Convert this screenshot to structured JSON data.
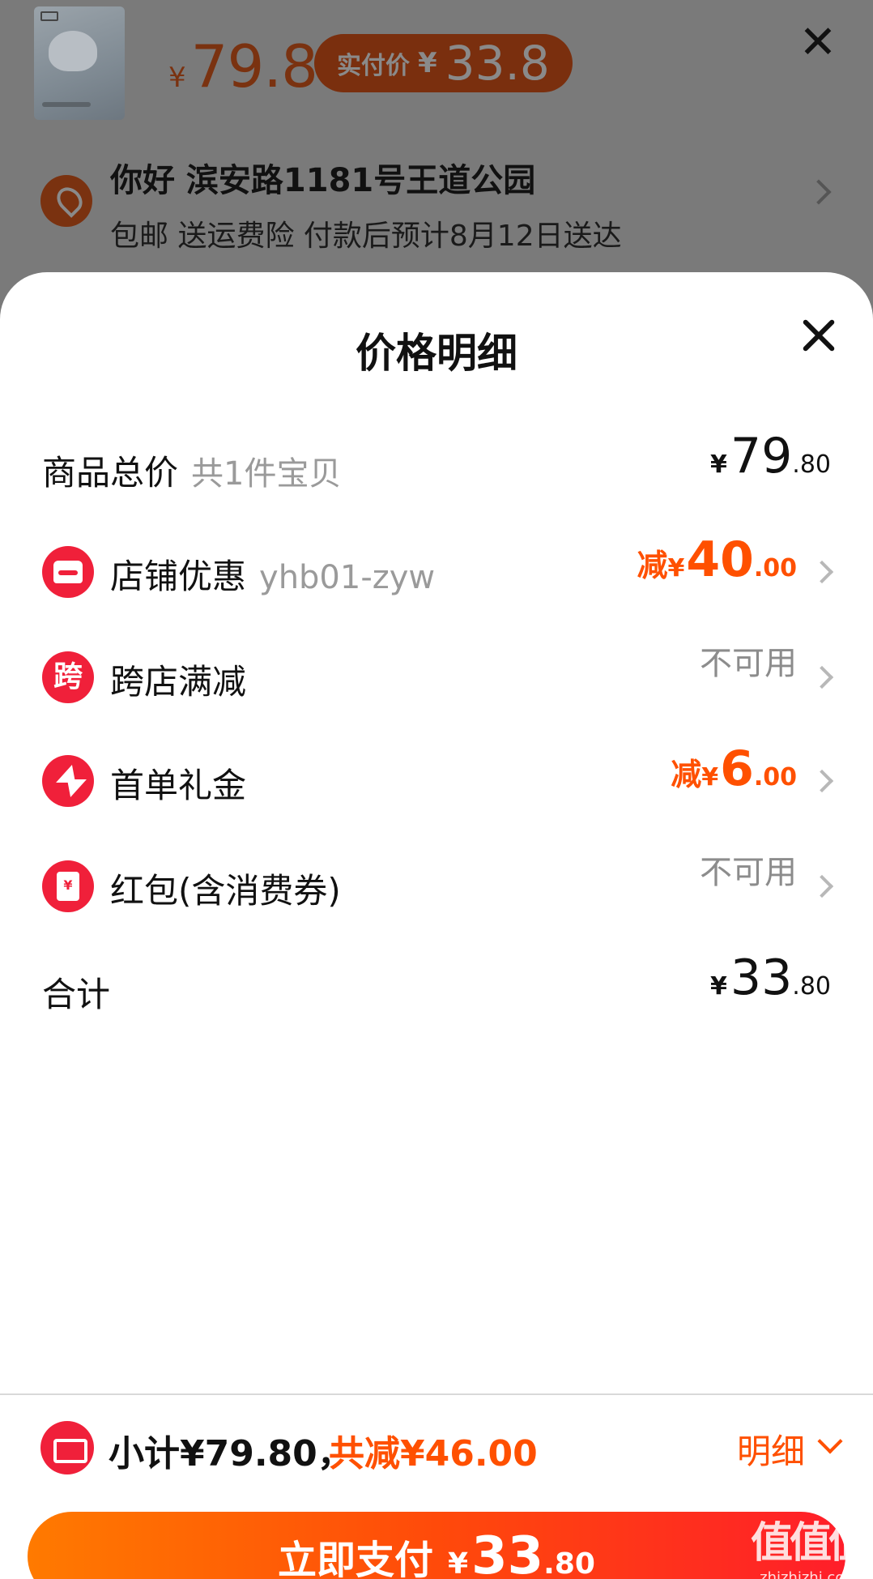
{
  "background": {
    "price_symbol": "¥",
    "price": "79.8",
    "paid_label": "实付价",
    "paid_symbol": "¥",
    "paid_value": "33.8",
    "address_title": "你好 滨安路1181号王道公园",
    "shipping_info": "包邮 送运费险 付款后预计8月12日送达"
  },
  "sheet": {
    "title": "价格明细",
    "rows": [
      {
        "label": "商品总价",
        "sub": "共1件宝贝",
        "yen": "¥",
        "amount_int": "79",
        "amount_dec": ".80"
      },
      {
        "label": "店铺优惠",
        "sub": "yhb01-zyw",
        "prefix": "减",
        "yen": "¥",
        "amount_int": "40",
        "amount_dec": ".00"
      },
      {
        "label": "跨店满减",
        "icon_text": "跨",
        "status": "不可用"
      },
      {
        "label": "首单礼金",
        "prefix": "减",
        "yen": "¥",
        "amount_int": "6",
        "amount_dec": ".00"
      },
      {
        "label": "红包(含消费券)",
        "status": "不可用"
      },
      {
        "label": "合计",
        "yen": "¥",
        "amount_int": "33",
        "amount_dec": ".80"
      }
    ]
  },
  "bottom_bar": {
    "subtotal": "小计¥79.80，",
    "saved": "共减¥46.00",
    "detail_label": "明细",
    "pay_label": "立即支付",
    "pay_yen": "¥",
    "pay_int": "33",
    "pay_dec": ".80"
  },
  "watermark": {
    "main": "值值值",
    "sub": "zhizhizhi.com"
  },
  "colors": {
    "accent_orange": "#ff5000",
    "icon_red": "#f0203a",
    "pay_gradient_start": "#ff7a00",
    "pay_gradient_end": "#ff1e2a"
  }
}
